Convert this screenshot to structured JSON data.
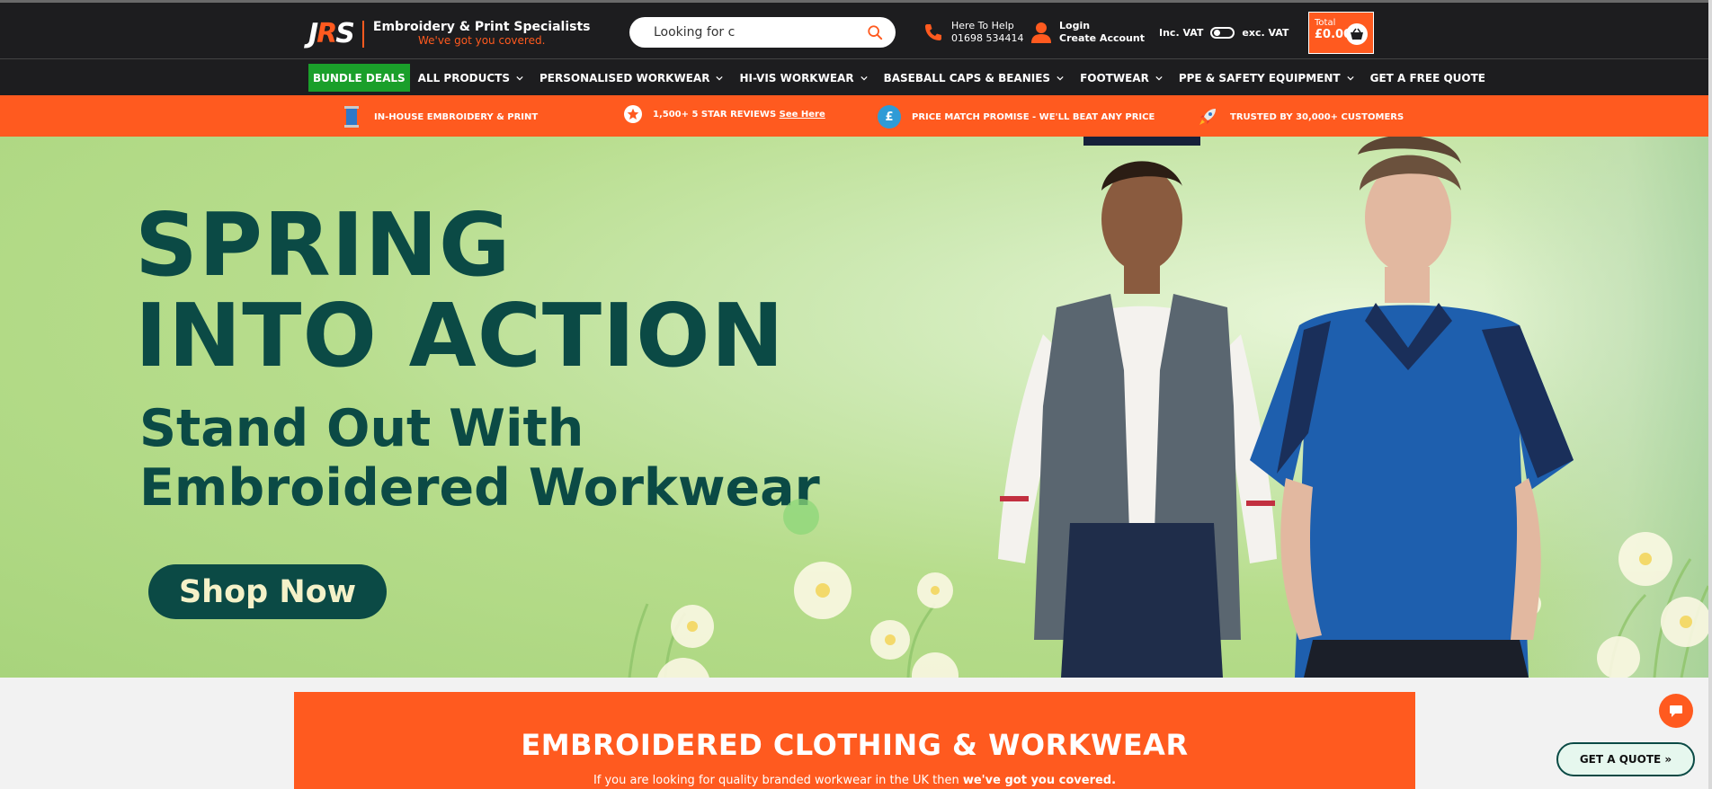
{
  "header": {
    "logo": {
      "mark": "JRS",
      "title": "Embroidery & Print Specialists",
      "tagline": "We've got you covered."
    },
    "search": {
      "placeholder": "Looking for c"
    },
    "help": {
      "line1": "Here To Help",
      "phone": "01698 534414"
    },
    "account": {
      "login": "Login",
      "create": "Create Account"
    },
    "vat": {
      "inc": "Inc. VAT",
      "exc": "exc. VAT"
    },
    "cart": {
      "label": "Total",
      "total": "£0.00"
    }
  },
  "nav": {
    "items": [
      {
        "label": "BUNDLE DEALS",
        "dropdown": false
      },
      {
        "label": "ALL PRODUCTS",
        "dropdown": true
      },
      {
        "label": "PERSONALISED WORKWEAR",
        "dropdown": true
      },
      {
        "label": "HI-VIS WORKWEAR",
        "dropdown": true
      },
      {
        "label": "BASEBALL CAPS & BEANIES",
        "dropdown": true
      },
      {
        "label": "FOOTWEAR",
        "dropdown": true
      },
      {
        "label": "PPE & SAFETY EQUIPMENT",
        "dropdown": true
      },
      {
        "label": "GET A FREE QUOTE",
        "dropdown": false
      }
    ]
  },
  "usp": [
    {
      "text": "IN-HOUSE EMBROIDERY & PRINT",
      "icon": "thread-spool-icon"
    },
    {
      "text": "1,500+ 5 STAR REVIEWS ",
      "link": "See Here",
      "icon": "star-icon"
    },
    {
      "text": "PRICE MATCH PROMISE - WE'LL BEAT ANY PRICE",
      "icon": "pound-icon"
    },
    {
      "text": "TRUSTED BY 30,000+ CUSTOMERS",
      "icon": "rocket-icon"
    }
  ],
  "hero": {
    "headline_1": "SPRING",
    "headline_2": "INTO ACTION",
    "sub_1": "Stand Out With",
    "sub_2": "Embroidered Workwear",
    "cta": "Shop Now"
  },
  "section": {
    "title": "EMBROIDERED CLOTHING & WORKWEAR",
    "text": "If you are looking for quality branded workwear in the UK then ",
    "text_bold": "we've got you covered."
  },
  "floating": {
    "quote": "GET A QUOTE »",
    "chat_icon": "chat-icon"
  },
  "colors": {
    "brand_orange": "#ff5a1f",
    "dark": "#1d1d1f",
    "hero_green": "#0b4a45",
    "deals_green": "#1a9f2a"
  }
}
